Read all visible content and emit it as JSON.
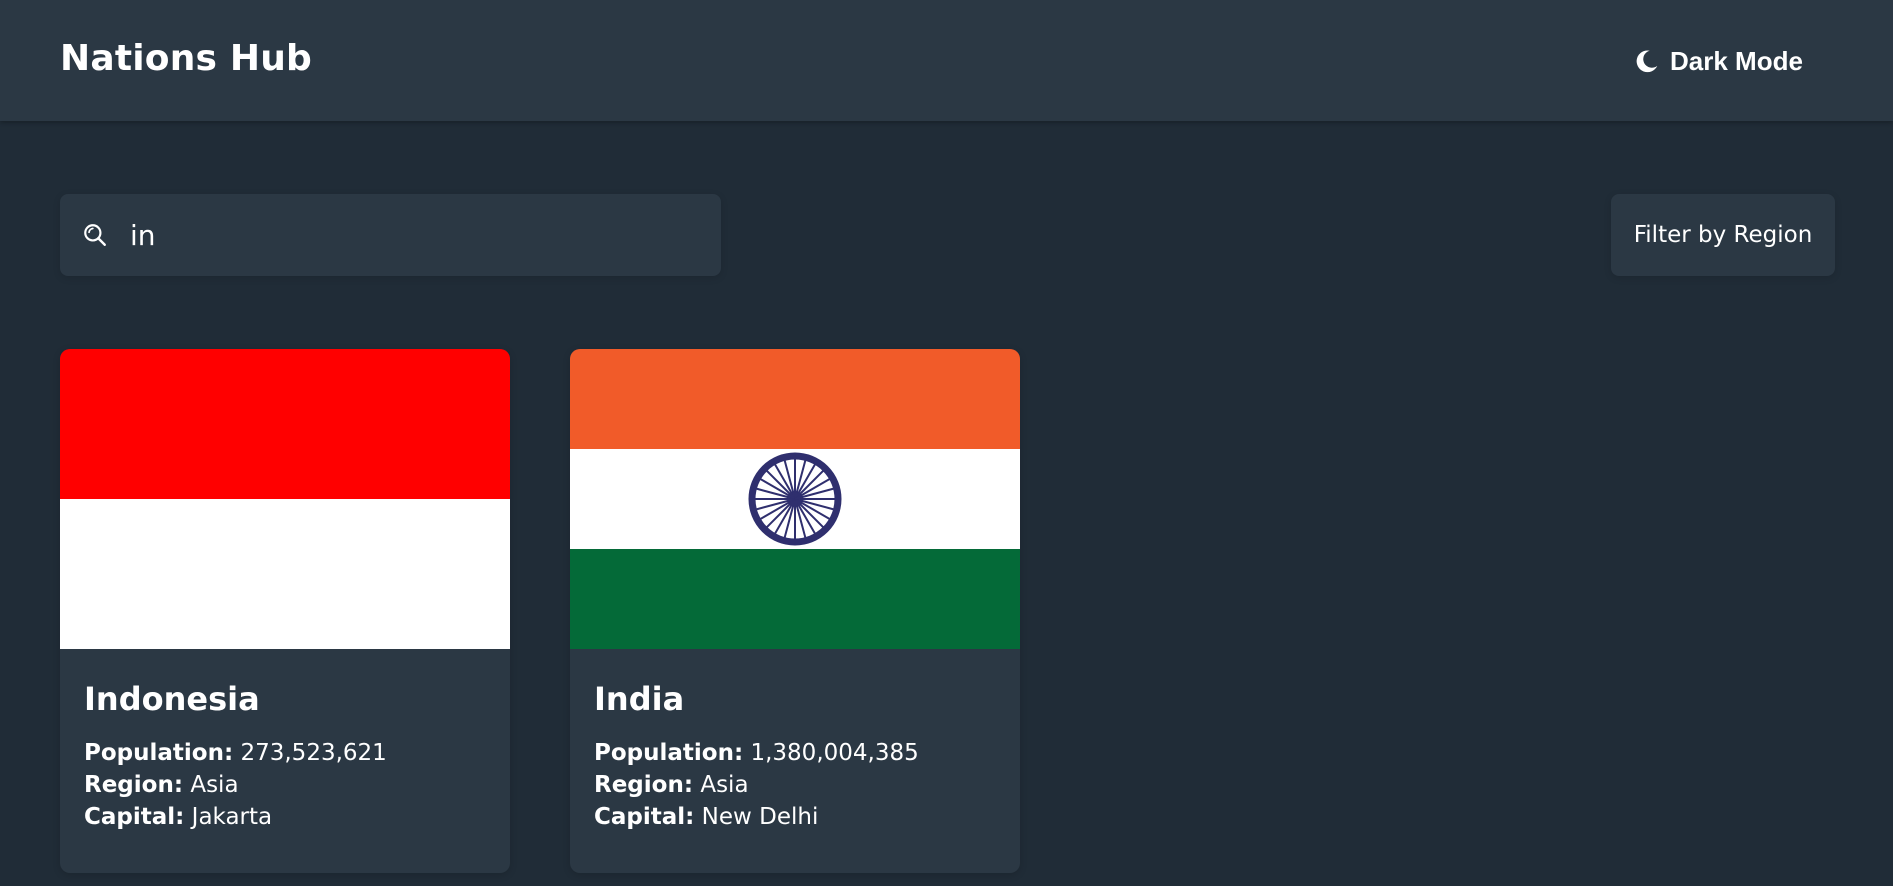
{
  "header": {
    "brand": "Nations Hub",
    "theme_toggle_label": "Dark Mode",
    "theme_icon": "moon-icon"
  },
  "search": {
    "value": "in",
    "icon": "search-icon"
  },
  "filter": {
    "label": "Filter by Region"
  },
  "labels": {
    "population": "Population:",
    "region": "Region:",
    "capital": "Capital:"
  },
  "countries": [
    {
      "name": "Indonesia",
      "population": "273,523,621",
      "region": "Asia",
      "capital": "Jakarta",
      "flag_colors": [
        "#ff0000",
        "#ffffff"
      ]
    },
    {
      "name": "India",
      "population": "1,380,004,385",
      "region": "Asia",
      "capital": "New Delhi",
      "flag_colors": [
        "#f15b29",
        "#ffffff",
        "#046a38",
        "#2f2f6e"
      ]
    }
  ],
  "colors": {
    "background": "#202c37",
    "element": "#2b3844",
    "text": "#ffffff"
  }
}
